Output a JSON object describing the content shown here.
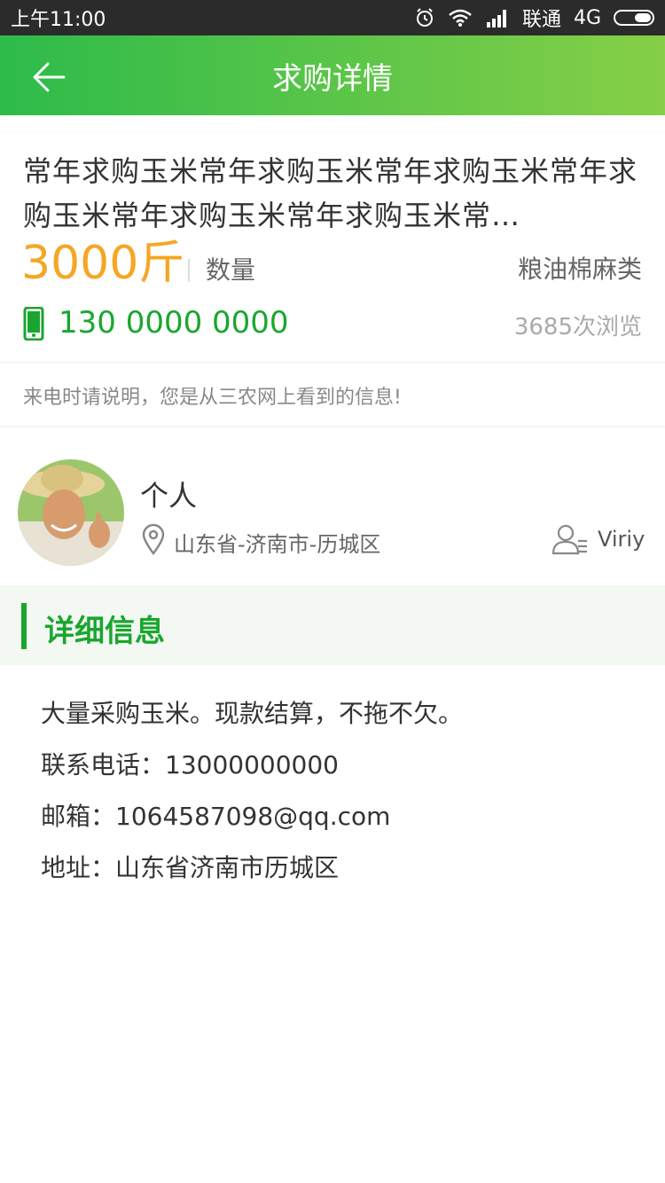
{
  "status_bar": {
    "time": "上午11:00",
    "carrier": "联通",
    "network": "4G",
    "icons": [
      "alarm-icon",
      "wifi-icon",
      "signal-icon",
      "battery-icon"
    ]
  },
  "navbar": {
    "title": "求购详情",
    "back_icon": "back-arrow-icon"
  },
  "listing": {
    "title": "常年求购玉米常年求购玉米常年求购玉米常年求购玉米常年求购玉米常年求购玉米常…",
    "quantity": "3000斤",
    "quantity_label": "数量",
    "category": "粮油棉麻类",
    "phone": "130 0000 0000",
    "views": "3685次浏览",
    "notice": "来电时请说明，您是从三农网上看到的信息!"
  },
  "user": {
    "type": "个人",
    "location": "山东省-济南市-历城区",
    "name": "Viriy"
  },
  "detail_section": {
    "title": "详细信息",
    "lines": [
      "大量采购玉米。现款结算，不拖不欠。",
      "联系电话：13000000000",
      "邮箱：1064587098@qq.com",
      "地址：山东省济南市历城区"
    ]
  },
  "colors": {
    "brand_green": "#1aa62e",
    "quantity_orange": "#f5a623",
    "nav_gradient_start": "#2dbb4a",
    "nav_gradient_end": "#86cf47"
  }
}
